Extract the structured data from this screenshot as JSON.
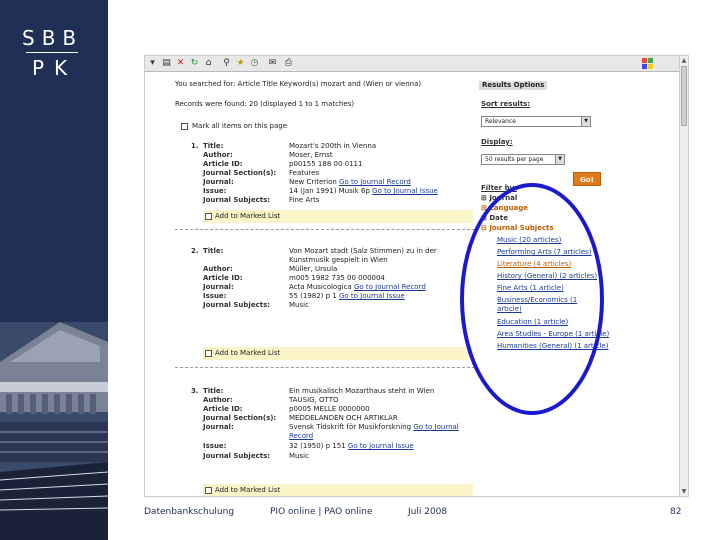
{
  "logo": {
    "line1": "SBB",
    "line2": "PK"
  },
  "toolbar": {
    "icons": [
      "dropdown-icon",
      "save-icon",
      "close-icon",
      "refresh-icon",
      "home-icon",
      "search-icon",
      "favorites-icon",
      "history-icon",
      "mail-icon",
      "print-icon"
    ]
  },
  "header": {
    "line1": "You searched for: Article Title Keyword(s) mozart and (Wien or vienna)",
    "line2": "Records were found: 20 (displayed 1 to 1 matches)",
    "mark_all": "Mark all items on this page"
  },
  "results": [
    {
      "number": "1.",
      "fields": [
        {
          "label": "Title:",
          "value": "Mozart's 200th in Vienna"
        },
        {
          "label": "Author:",
          "value": "Moser, Ernst"
        },
        {
          "label": "Article ID:",
          "value": "p00155 188 00 0111"
        },
        {
          "label": "Journal Section(s):",
          "value": "Features"
        },
        {
          "label": "Journal:",
          "value": "New Criterion",
          "link": "Go to Journal Record"
        },
        {
          "label": "Issue:",
          "value": "14 (Jan 1991) Musik 6p",
          "link": "Go to Journal Issue"
        },
        {
          "label": "Journal Subjects:",
          "value": "Fine Arts"
        }
      ],
      "marked_label": "Add to Marked List"
    },
    {
      "number": "2.",
      "fields": [
        {
          "label": "Title:",
          "value": "Von Mozart stadt (Salz Stimmen) zu in der"
        },
        {
          "label": "",
          "value": "Kunstmusik gespielt in Wien"
        },
        {
          "label": "Author:",
          "value": "Müller, Ursula"
        },
        {
          "label": "Article ID:",
          "value": "m005 1982 735 00 000004"
        },
        {
          "label": "Journal:",
          "value": "Acta Musicologica",
          "link": "Go to Journal Record"
        },
        {
          "label": "Issue:",
          "value": "55 (1982) p 1",
          "link": "Go to Journal Issue"
        },
        {
          "label": "Journal Subjects:",
          "value": "Music"
        }
      ],
      "marked_label": "Add to Marked List"
    },
    {
      "number": "3.",
      "fields": [
        {
          "label": "Title:",
          "value": "Ein musikalisch Mozarthaus steht in Wien"
        },
        {
          "label": "Author:",
          "value": "TAUSIG, OTTO"
        },
        {
          "label": "Article ID:",
          "value": "p0005 MELLE 0000000"
        },
        {
          "label": "Journal Section(s):",
          "value": "MEDDELANDEN OCH ARTIKLAR"
        },
        {
          "label": "Journal:",
          "value": "Svensk Tidskrift för Musikforskning",
          "link": "Go to Journal"
        },
        {
          "label": "",
          "value": "Record"
        },
        {
          "label": "Issue:",
          "value": "32 (1950) p 151",
          "link": "Go to Journal Issue"
        },
        {
          "label": "Journal Subjects:",
          "value": "Music"
        }
      ],
      "marked_label": "Add to Marked List"
    }
  ],
  "sidebar": {
    "results_options": "Results Options",
    "sort_label": "Sort results:",
    "sort_value": "Relevance",
    "display_label": "Display:",
    "display_value": "50 results per page",
    "go_label": "Go!",
    "filter_label": "Filter by:",
    "filters": [
      "Journal",
      "Language",
      "Date",
      "Journal Subjects"
    ],
    "subjects": [
      "Music (20 articles)",
      "Performing Arts (7 articles)",
      "Literature (4 articles)",
      "History (General) (2 articles)",
      "Fine Arts (1 article)",
      "Business/Economics (1 article)",
      "Education (1 article)",
      "Area Studies - Europe (1 article)",
      "Humanities (General) (1 article)"
    ]
  },
  "footer": {
    "left": "Datenbankschulung",
    "center": "PIO online | PAO online",
    "date": "Juli 2008",
    "page": "82"
  },
  "colors": {
    "panel": "#1f2f55",
    "highlight": "#1a1acc",
    "go": "#e07a1a",
    "marked": "#fbf4c8"
  }
}
